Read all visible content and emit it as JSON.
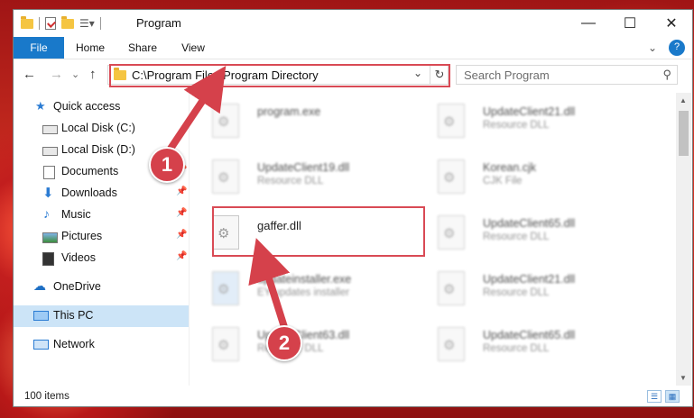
{
  "window": {
    "title": "Program",
    "minimize": "—",
    "maximize": "☐",
    "close": "✕"
  },
  "ribbon": {
    "tabs": [
      "File",
      "Home",
      "Share",
      "View"
    ],
    "expand": "⌄",
    "help": "?"
  },
  "address": {
    "path": "C:\\Program Files\\Program Directory",
    "dropdown": "⌄",
    "refresh": "↻"
  },
  "search": {
    "placeholder": "Search Program",
    "icon": "search-icon"
  },
  "nav": {
    "back": "←",
    "forward": "→",
    "recent": "⌄",
    "up": "↑"
  },
  "sidebar": {
    "items": [
      {
        "label": "Quick access",
        "icon": "star-icon"
      },
      {
        "label": "Local Disk (C:)",
        "icon": "drive-icon"
      },
      {
        "label": "Local Disk (D:)",
        "icon": "drive-icon"
      },
      {
        "label": "Documents",
        "icon": "document-icon",
        "pinned": true
      },
      {
        "label": "Downloads",
        "icon": "download-icon",
        "pinned": true
      },
      {
        "label": "Music",
        "icon": "music-icon",
        "pinned": true
      },
      {
        "label": "Pictures",
        "icon": "picture-icon",
        "pinned": true
      },
      {
        "label": "Videos",
        "icon": "video-icon",
        "pinned": true
      },
      {
        "label": "OneDrive",
        "icon": "cloud-icon"
      },
      {
        "label": "This PC",
        "icon": "pc-icon"
      },
      {
        "label": "Network",
        "icon": "network-icon"
      }
    ]
  },
  "files": [
    {
      "name": "program.exe",
      "type": ""
    },
    {
      "name": "UpdateClient21.dll",
      "type": "Resource DLL"
    },
    {
      "name": "UpdateClient19.dll",
      "type": "Resource DLL"
    },
    {
      "name": "Korean.cjk",
      "type": "CJK File"
    },
    {
      "name": "gaffer.dll",
      "type": ""
    },
    {
      "name": "UpdateClient65.dll",
      "type": "Resource DLL"
    },
    {
      "name": "updateinstaller.exe",
      "type": "EY updates installer"
    },
    {
      "name": "UpdateClient21.dll",
      "type": "Resource DLL"
    },
    {
      "name": "UpdateClient63.dll",
      "type": "Resource DLL"
    },
    {
      "name": "UpdateClient65.dll",
      "type": "Resource DLL"
    }
  ],
  "status": {
    "count": "100 items"
  },
  "annotations": {
    "step1": "1",
    "step2": "2",
    "color": "#d5414b"
  }
}
